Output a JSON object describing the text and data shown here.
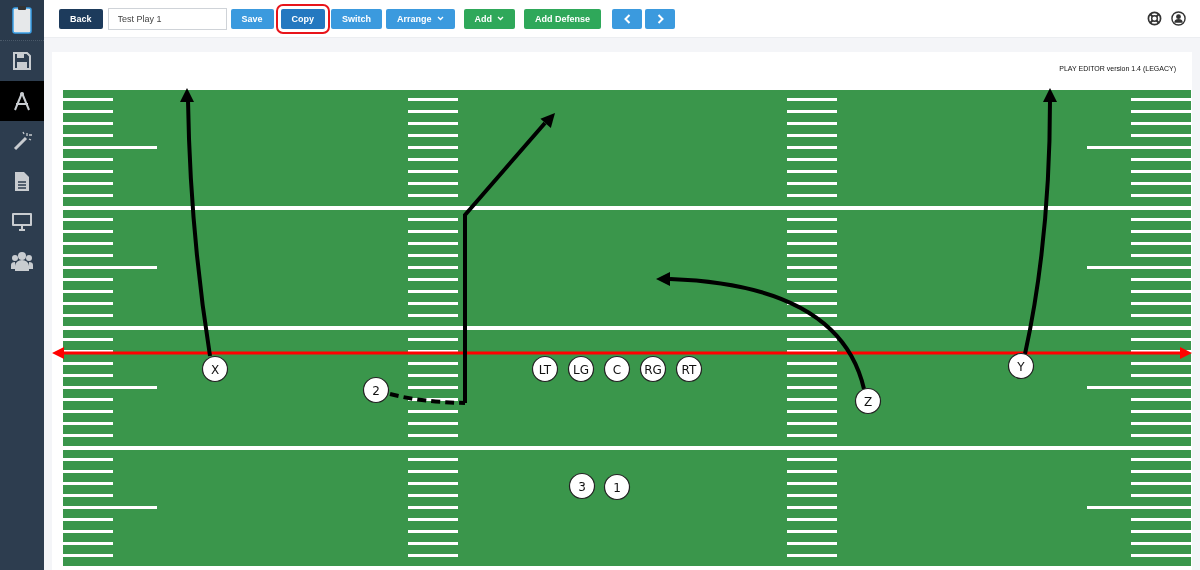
{
  "sidebar": {
    "items": [
      {
        "kind": "logo",
        "selected": false
      },
      {
        "kind": "save",
        "selected": false
      },
      {
        "kind": "editor",
        "selected": true
      },
      {
        "kind": "wand",
        "selected": false
      },
      {
        "kind": "document",
        "selected": false
      },
      {
        "kind": "monitor",
        "selected": false
      },
      {
        "kind": "team",
        "selected": false
      }
    ]
  },
  "toolbar": {
    "back_button": {
      "label": "Back"
    },
    "play_name_field": {
      "value": "Test Play 1"
    },
    "buttons": [
      {
        "label": "Save",
        "kind": "primary",
        "dropdown": false,
        "highlighted": false
      },
      {
        "label": "Copy",
        "kind": "primary",
        "dropdown": false,
        "highlighted": true
      },
      {
        "label": "Switch",
        "kind": "primary",
        "dropdown": false,
        "highlighted": false
      },
      {
        "label": "Arrange",
        "kind": "primary",
        "dropdown": true,
        "highlighted": false
      },
      {
        "label": "Add",
        "kind": "success",
        "dropdown": true,
        "highlighted": false
      },
      {
        "label": "Add Defense",
        "kind": "success",
        "dropdown": false,
        "highlighted": false
      }
    ]
  },
  "editor": {
    "version": "PLAY EDITOR version 1.4 (LEGACY)",
    "players": [
      {
        "label": "X"
      },
      {
        "label": "2"
      },
      {
        "label": "LT"
      },
      {
        "label": "LG"
      },
      {
        "label": "C"
      },
      {
        "label": "RG"
      },
      {
        "label": "RT"
      },
      {
        "label": "Z"
      },
      {
        "label": "Y"
      },
      {
        "label": "3"
      },
      {
        "label": "1"
      }
    ]
  }
}
